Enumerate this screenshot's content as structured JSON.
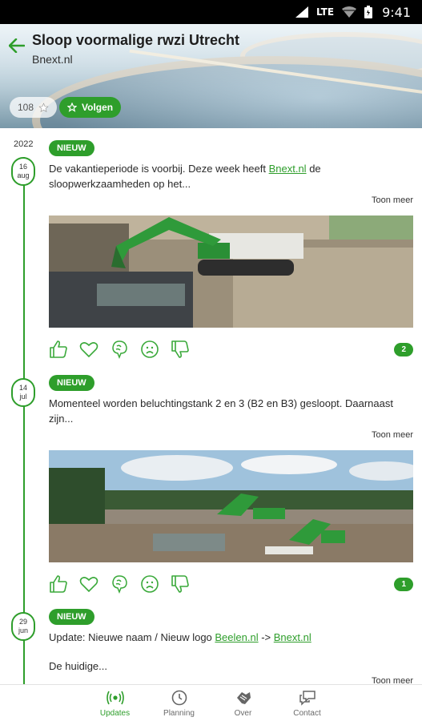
{
  "status_bar": {
    "network": "LTE",
    "time": "9:41"
  },
  "header": {
    "title": "Sloop voormalige rwzi Utrecht",
    "subtitle": "Bnext.nl",
    "favorites_count": "108",
    "follow_label": "Volgen"
  },
  "timeline": {
    "year": "2022",
    "posts": [
      {
        "day": "16",
        "month": "aug",
        "badge": "NIEUW",
        "text_before": "De vakantieperiode is voorbij. Deze week heeft ",
        "link1": "Bnext.nl",
        "text_after": " de sloopwerkzaamheden op het...",
        "more": "Toon meer",
        "reaction_count": "2"
      },
      {
        "day": "14",
        "month": "jul",
        "badge": "NIEUW",
        "text": "Momenteel worden beluchtingstank 2 en 3 (B2 en B3) gesloopt. Daarnaast zijn...",
        "more": "Toon meer",
        "reaction_count": "1"
      },
      {
        "day": "29",
        "month": "jun",
        "badge": "NIEUW",
        "text_before": "Update: Nieuwe naam / Nieuw logo ",
        "link1": "Beelen.nl",
        "mid": " -> ",
        "link2": "Bnext.nl",
        "text2": "De huidige...",
        "more": "Toon meer"
      }
    ]
  },
  "bottom_nav": [
    {
      "label": "Updates",
      "icon": "broadcast-icon",
      "active": true
    },
    {
      "label": "Planning",
      "icon": "clock-icon",
      "active": false
    },
    {
      "label": "Over",
      "icon": "hands-icon",
      "active": false
    },
    {
      "label": "Contact",
      "icon": "chat-icon",
      "active": false
    }
  ],
  "colors": {
    "accent": "#2e9e2b"
  }
}
